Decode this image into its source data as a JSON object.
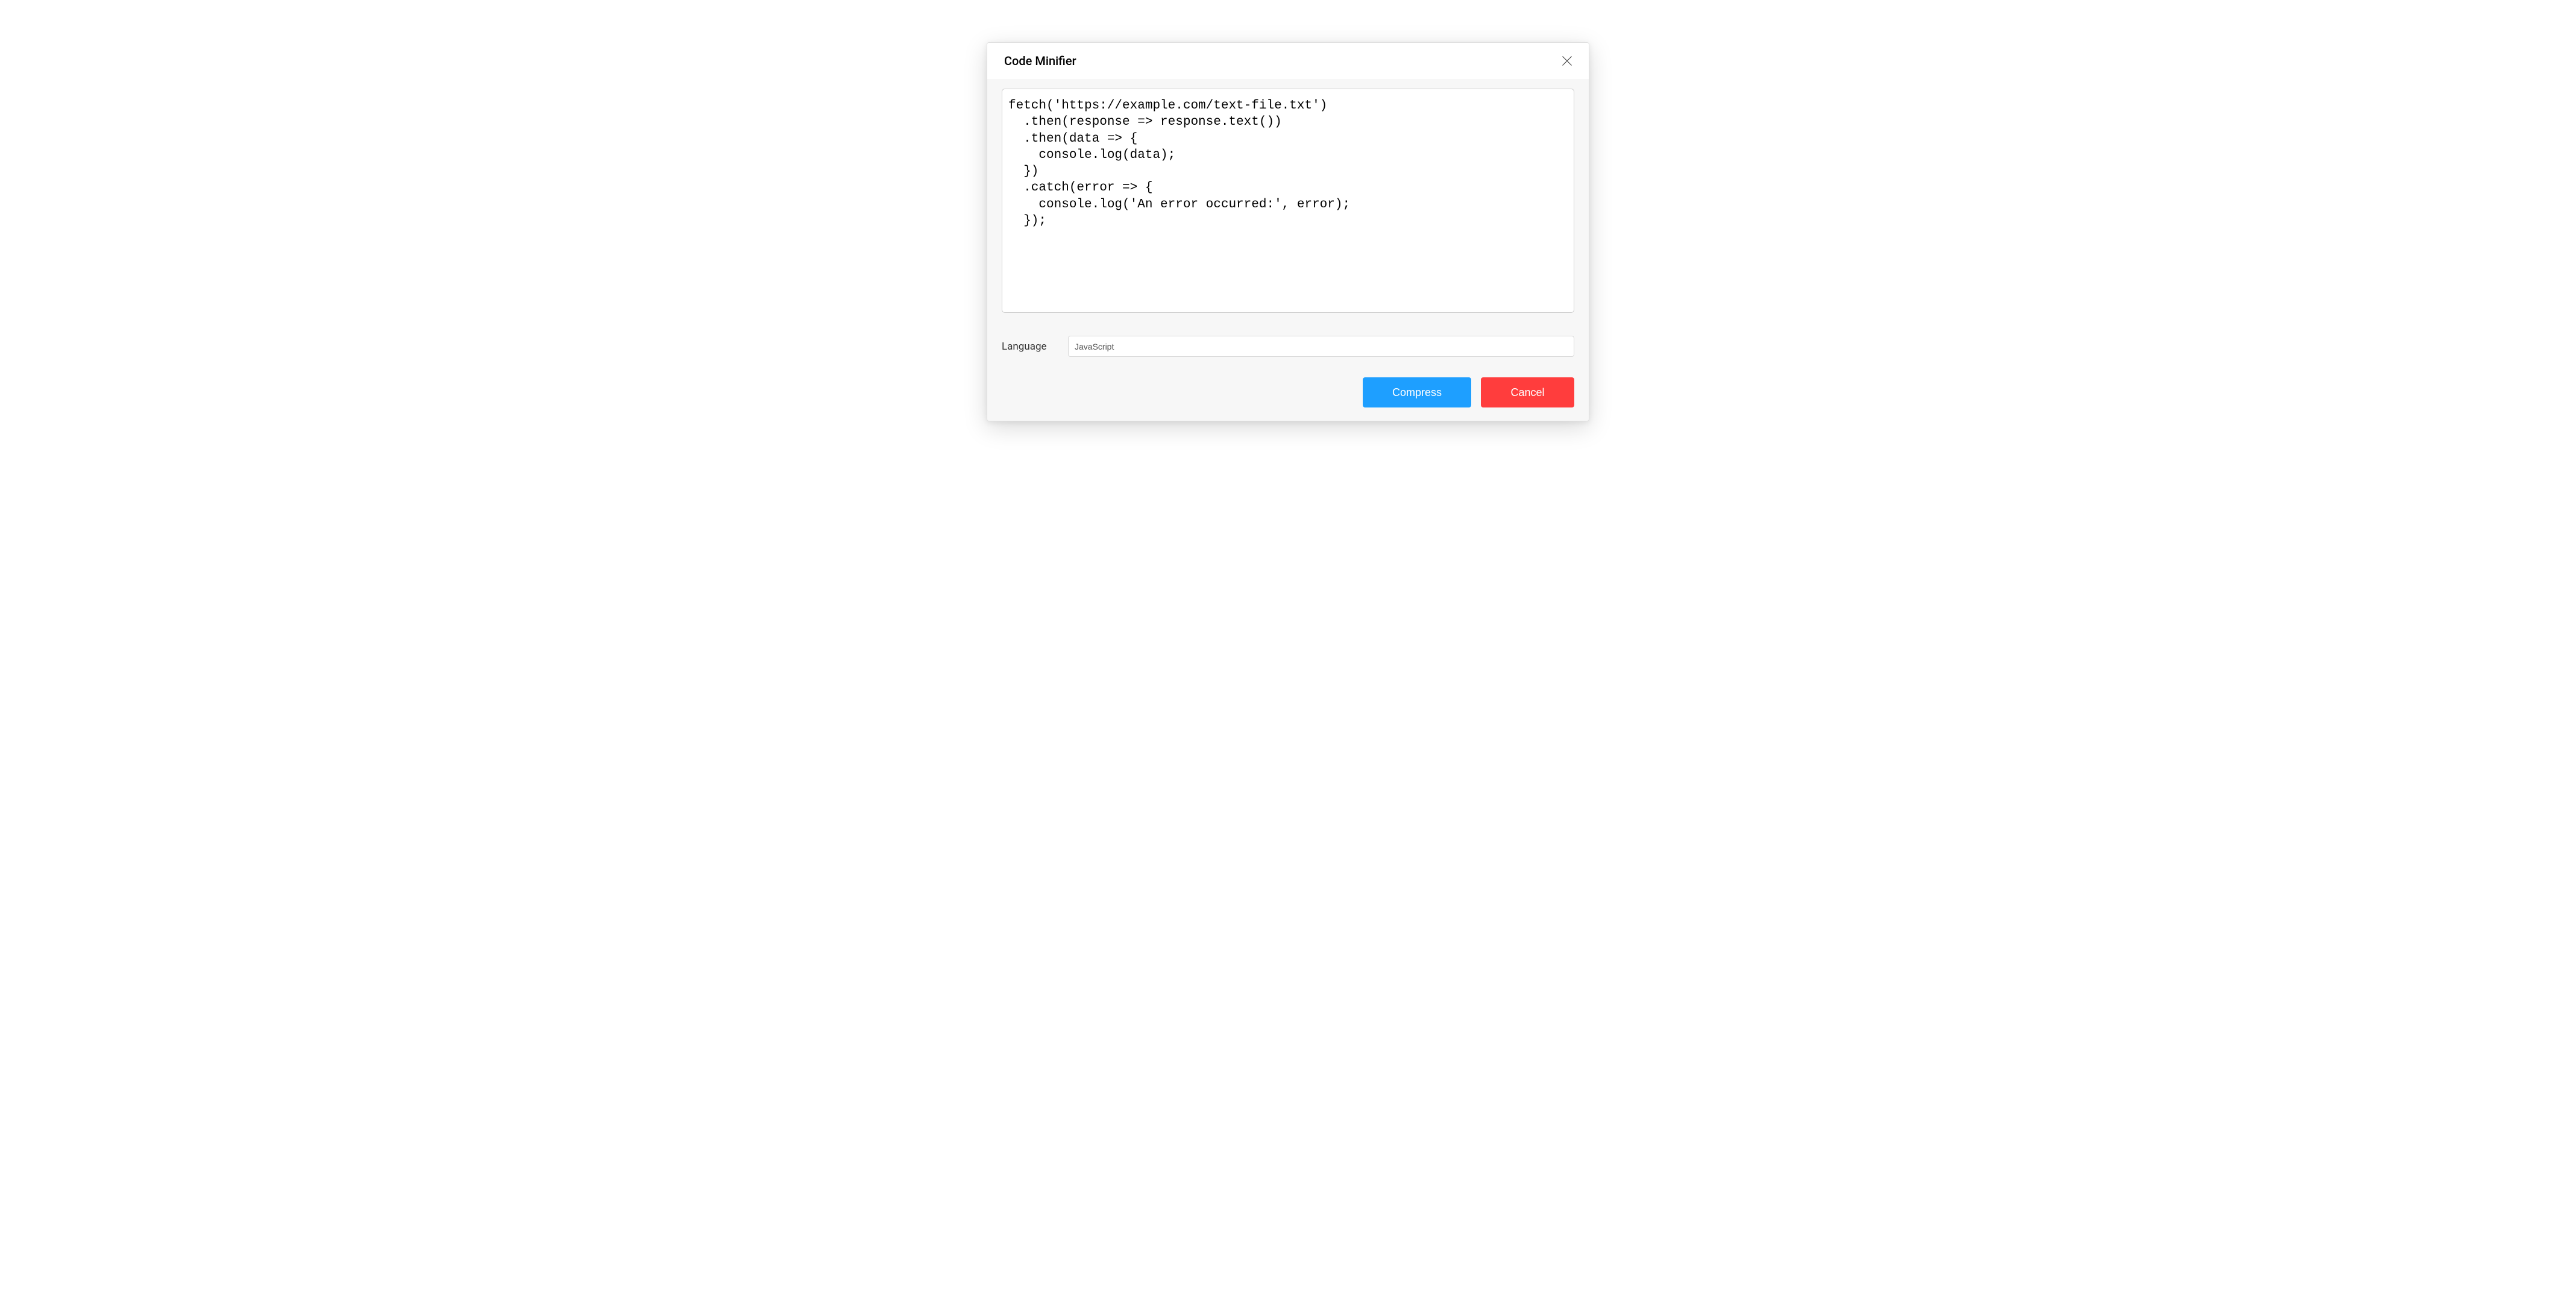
{
  "modal": {
    "title": "Code Minifier",
    "code_value": "fetch('https://example.com/text-file.txt')\n  .then(response => response.text())\n  .then(data => {\n    console.log(data);\n  })\n  .catch(error => {\n    console.log('An error occurred:', error);\n  });",
    "language_label": "Language",
    "language_value": "JavaScript",
    "compress_label": "Compress",
    "cancel_label": "Cancel"
  }
}
